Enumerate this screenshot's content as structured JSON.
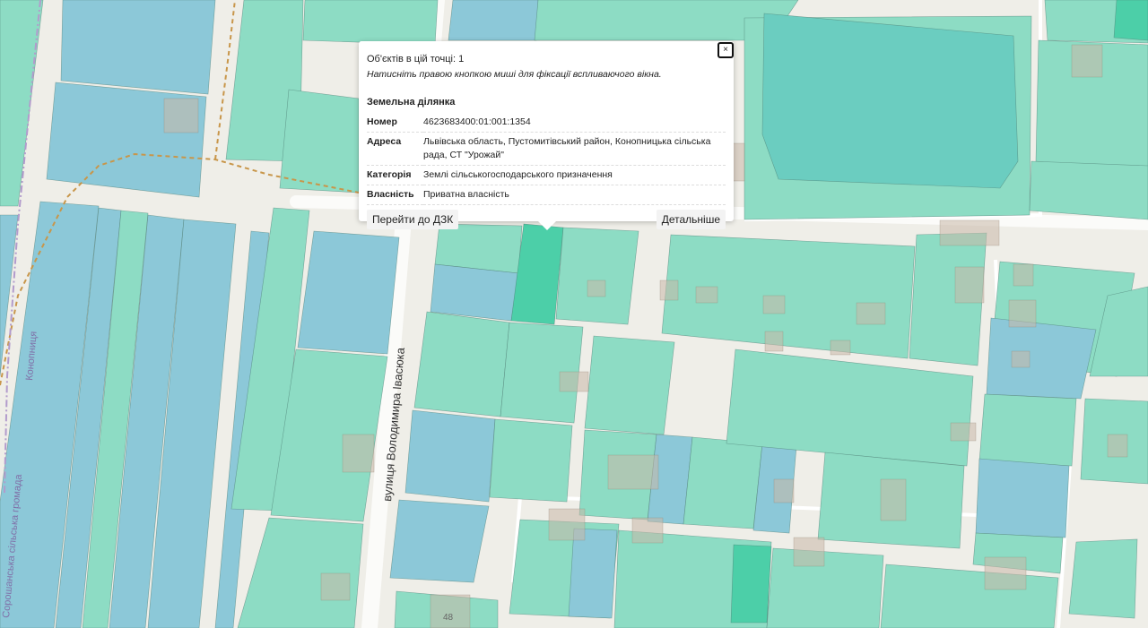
{
  "popup": {
    "count_text": "Об'єктів в цій точці: 1",
    "hint": "Натисніть правою кнопкою миші для фіксації вспливаючого вікна.",
    "close_label": "×",
    "title": "Земельна ділянка",
    "rows": [
      {
        "key": "Номер",
        "value": "4623683400:01:001:1354"
      },
      {
        "key": "Адреса",
        "value": "Львівська область, Пустомитівський район, Конопницька сільська рада, СТ \"Урожай\""
      },
      {
        "key": "Категорія",
        "value": "Землі сільськогосподарського призначення"
      },
      {
        "key": "Власність",
        "value": "Приватна власність"
      }
    ],
    "button_left": "Перейти до ДЗК",
    "button_right": "Детальніше"
  },
  "map_labels": {
    "street": "вулиця Володимира Івасюка",
    "council_short": "Конопниця",
    "council_full": "Сорошанська сільська громада",
    "house_number": "48"
  },
  "colors": {
    "background": "#efeee8",
    "parcel_green": "#8ddcc4",
    "parcel_blue": "#8cc8d8",
    "parcel_selected": "#4ccfa8",
    "water": "#6bcdc0",
    "building": "#c8b8a8"
  }
}
